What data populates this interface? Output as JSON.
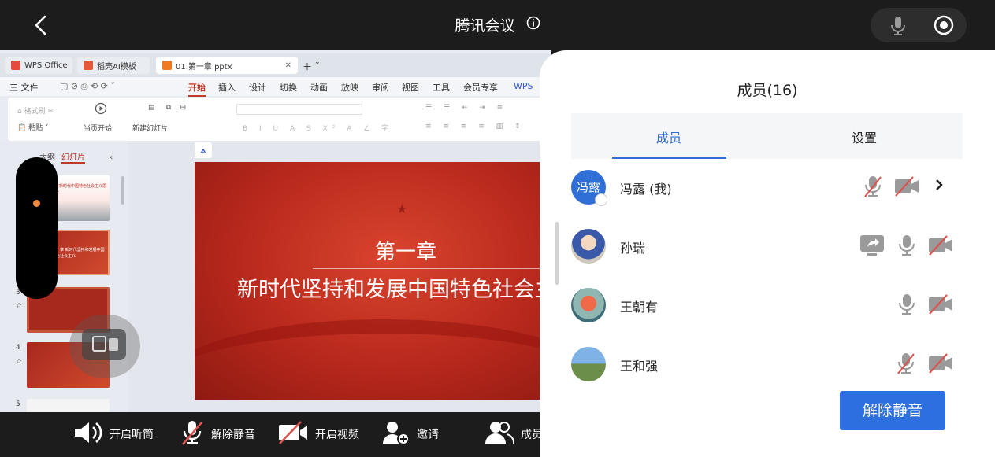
{
  "header": {
    "title": "腾讯会议"
  },
  "shared_screen": {
    "tabs": [
      {
        "label": "WPS Office",
        "color": "#e54a3c"
      },
      {
        "label": "稻壳AI模板",
        "color": "#e5573b"
      },
      {
        "label": "01.第一章.pptx",
        "color": "#f07a23"
      }
    ],
    "menu": [
      "三 文件",
      "开始",
      "插入",
      "设计",
      "切换",
      "动画",
      "放映",
      "审阅",
      "视图",
      "工具",
      "会员专享",
      "WPS"
    ],
    "ribbon": {
      "format_painter": "格式刷",
      "paste": "粘贴",
      "from_current": "当页开始",
      "new_slide": "新建幻灯片"
    },
    "panel_tabs": {
      "outline": "大纲",
      "slides": "幻灯片"
    },
    "slide_numbers": [
      "3",
      "4",
      "5"
    ],
    "slide": {
      "heading": "第一章",
      "subtitle": "新时代坚持和发展中国特色社会主"
    },
    "thumbnails": {
      "t1": "习近平新时代中国特色社会主义思想概论",
      "t2": "第一章 新时代坚持和发展中国特色社会主义"
    }
  },
  "toolbar": {
    "speaker": "开启听筒",
    "unmute": "解除静音",
    "video": "开启视频",
    "invite": "邀请",
    "members": "成员"
  },
  "members_panel": {
    "title": "成员(16)",
    "tabs": {
      "members": "成员",
      "settings": "设置"
    },
    "members": [
      {
        "avatar_text": "冯露",
        "name": "冯露 (我)"
      },
      {
        "name": "孙瑞"
      },
      {
        "name": "王朝有"
      },
      {
        "name": "王和强"
      }
    ],
    "unmute_button": "解除静音"
  },
  "colors": {
    "accent": "#2f6fd6",
    "unmute_btn": "#2e6fe0",
    "muted_red": "#d9534f",
    "slide_red": "#c3321f"
  }
}
